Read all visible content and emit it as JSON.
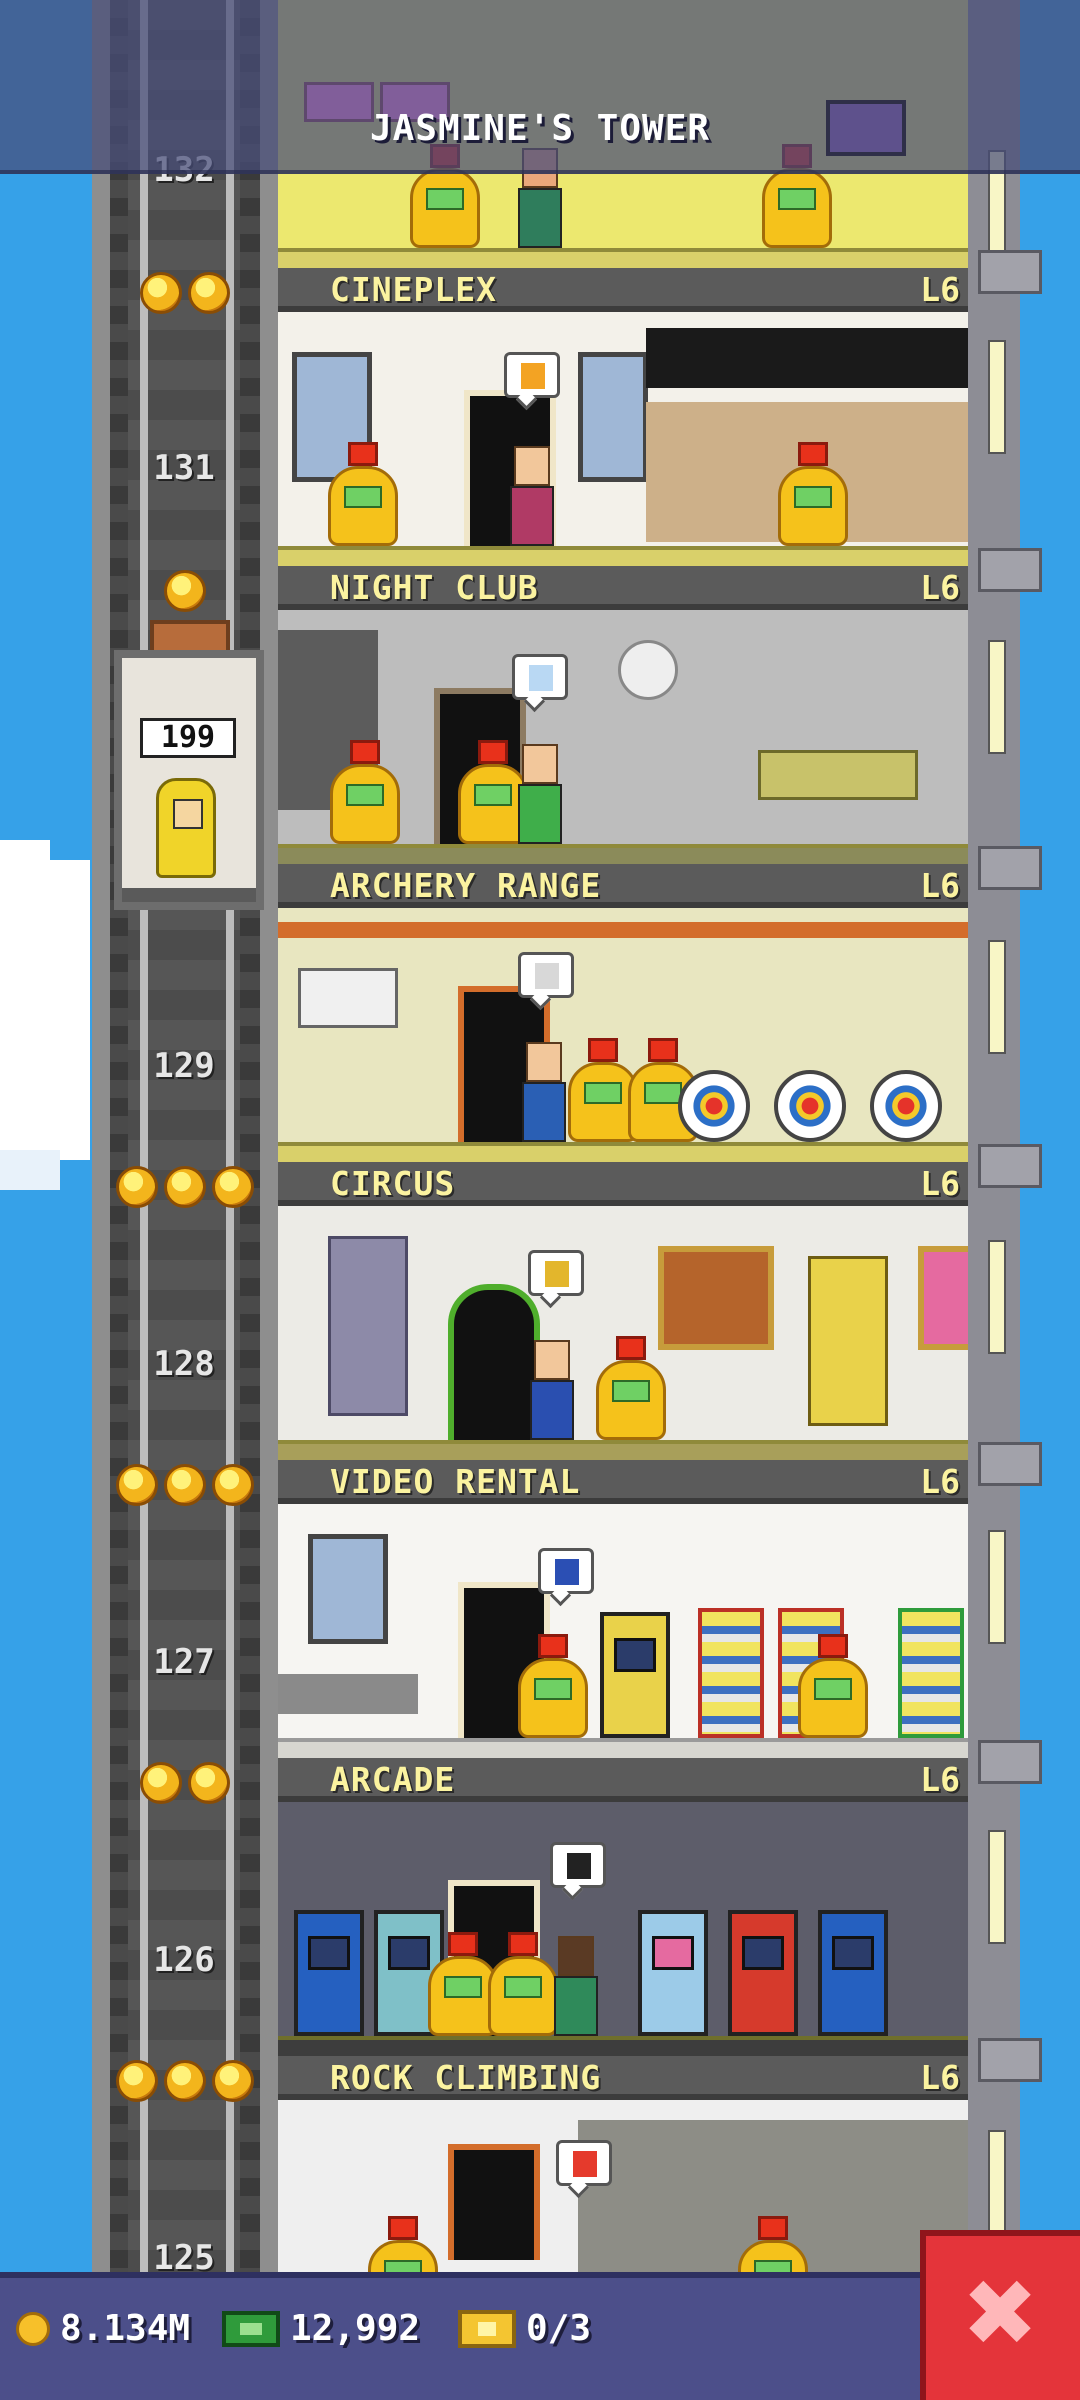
{
  "header": {
    "title": "JASMINE'S TOWER"
  },
  "elevator": {
    "car_number": "199"
  },
  "floors": [
    {
      "name": "CINEPLEX",
      "level": "L6"
    },
    {
      "name": "NIGHT CLUB",
      "level": "L6"
    },
    {
      "name": "ARCHERY RANGE",
      "level": "L6"
    },
    {
      "name": "CIRCUS",
      "level": "L6"
    },
    {
      "name": "VIDEO RENTAL",
      "level": "L6"
    },
    {
      "name": "ARCADE",
      "level": "L6"
    },
    {
      "name": "ROCK CLIMBING",
      "level": "L6"
    }
  ],
  "floor_numbers": [
    "132",
    "131",
    "129",
    "128",
    "127",
    "126",
    "125"
  ],
  "status_bar": {
    "coins": "8.134M",
    "bux": "12,992",
    "tickets": "0/3"
  },
  "colors": {
    "banner_text": "#fbf3a0",
    "close_button": "#e4343a",
    "status_bar": "#4c4f8a"
  },
  "icons": [
    "coin-icon",
    "bux-icon",
    "ticket-icon",
    "close-icon",
    "star-icon"
  ]
}
